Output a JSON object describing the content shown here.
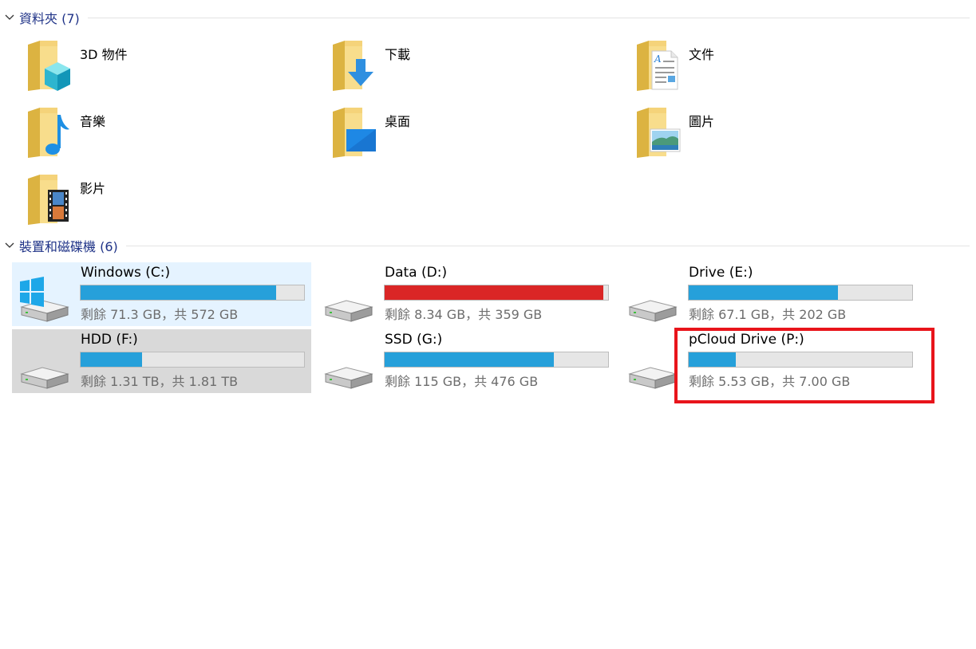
{
  "groups": {
    "folders": {
      "title": "資料夾 (7)"
    },
    "devices": {
      "title": "裝置和磁碟機 (6)"
    }
  },
  "folders": [
    {
      "name": "3D 物件",
      "icon": "3d-objects-icon"
    },
    {
      "name": "下載",
      "icon": "download-arrow-icon"
    },
    {
      "name": "文件",
      "icon": "document-icon"
    },
    {
      "name": "音樂",
      "icon": "music-note-icon"
    },
    {
      "name": "桌面",
      "icon": "desktop-icon"
    },
    {
      "name": "圖片",
      "icon": "picture-icon"
    },
    {
      "name": "影片",
      "icon": "film-icon"
    }
  ],
  "drives": [
    {
      "name": "Windows (C:)",
      "free": "剩餘 71.3 GB，共 572 GB",
      "used_pct": 87.5,
      "color": "#26a0da",
      "state": "selected",
      "icon": "windows-drive-icon"
    },
    {
      "name": "Data (D:)",
      "free": "剩餘 8.34 GB，共 359 GB",
      "used_pct": 97.7,
      "color": "#da2626",
      "state": "normal",
      "icon": "hard-drive-icon"
    },
    {
      "name": "Drive (E:)",
      "free": "剩餘 67.1 GB，共 202 GB",
      "used_pct": 66.8,
      "color": "#26a0da",
      "state": "normal",
      "icon": "hard-drive-icon"
    },
    {
      "name": "HDD (F:)",
      "free": "剩餘 1.31 TB，共 1.81 TB",
      "used_pct": 27.6,
      "color": "#26a0da",
      "state": "hover",
      "icon": "hard-drive-icon"
    },
    {
      "name": "SSD (G:)",
      "free": "剩餘 115 GB，共 476 GB",
      "used_pct": 75.8,
      "color": "#26a0da",
      "state": "normal",
      "icon": "hard-drive-icon"
    },
    {
      "name": "pCloud Drive (P:)",
      "free": "剩餘 5.53 GB，共 7.00 GB",
      "used_pct": 21.0,
      "color": "#26a0da",
      "state": "normal",
      "icon": "hard-drive-icon"
    }
  ],
  "colors": {
    "header_text": "#1e3287",
    "bar_normal": "#26a0da",
    "bar_full": "#da2626",
    "annotation": "#e8141b"
  }
}
